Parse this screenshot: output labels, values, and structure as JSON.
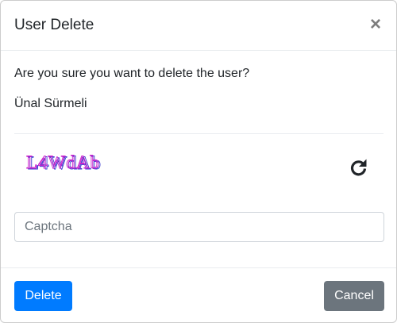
{
  "modal": {
    "title": "User Delete",
    "close_symbol": "×"
  },
  "body": {
    "question": "Are you sure you want to delete the user?",
    "user_name": "Ünal Sürmeli",
    "captcha_text": "L4WdAb",
    "refresh_icon": "refresh-icon",
    "captcha_input": {
      "placeholder": "Captcha",
      "value": ""
    }
  },
  "footer": {
    "delete_label": "Delete",
    "cancel_label": "Cancel"
  },
  "colors": {
    "primary": "#007bff",
    "secondary": "#6c757d",
    "captcha_magenta": "#cc22cc",
    "captcha_blue": "#3a3ad0"
  }
}
